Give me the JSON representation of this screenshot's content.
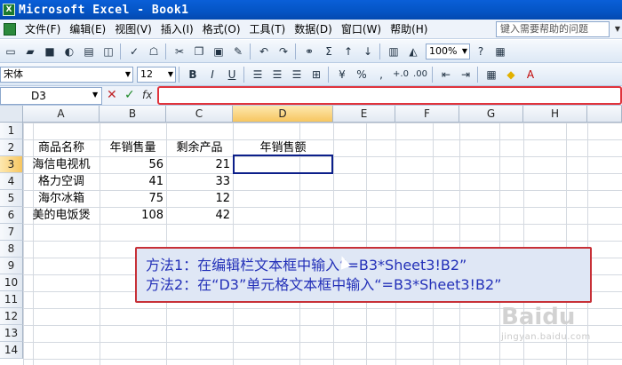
{
  "window": {
    "title": "Microsoft Excel - Book1"
  },
  "menu": {
    "items": [
      "文件(F)",
      "编辑(E)",
      "视图(V)",
      "插入(I)",
      "格式(O)",
      "工具(T)",
      "数据(D)",
      "窗口(W)",
      "帮助(H)"
    ],
    "help_placeholder": "键入需要帮助的问题"
  },
  "toolbar": {
    "zoom": "100%",
    "font_name": "宋体",
    "font_size": "12",
    "bold": "B",
    "italic": "I",
    "underline": "U",
    "currency": "%",
    "comma": ",",
    "inc_decimal": "+.0",
    "dec_decimal": ".00"
  },
  "formula_bar": {
    "name_box": "D3",
    "cancel": "✕",
    "enter": "✓",
    "fx": "fx",
    "value": ""
  },
  "sheet": {
    "columns": [
      "A",
      "B",
      "C",
      "D",
      "E",
      "F",
      "G",
      "H"
    ],
    "rows": [
      "1",
      "2",
      "3",
      "4",
      "5",
      "6",
      "7",
      "8",
      "9",
      "10",
      "11",
      "12",
      "13",
      "14"
    ],
    "active_cell": "D3",
    "cells": {
      "A2": "商品名称",
      "B2": "年销售量",
      "C2": "剩余产品",
      "D2": "年销售额",
      "A3": "海信电视机",
      "B3": "56",
      "C3": "21",
      "A4": "格力空调",
      "B4": "41",
      "C4": "33",
      "A5": "海尔冰箱",
      "B5": "75",
      "C5": "12",
      "A6": "美的电饭煲",
      "B6": "108",
      "C6": "42"
    }
  },
  "annotation": {
    "line1": "方法1：在编辑栏文本框中输入“=B3*Sheet3!B2”",
    "line2": "方法2：在“D3”单元格文本框中输入“=B3*Sheet3!B2”"
  },
  "watermark": {
    "logo": "Baidu",
    "sub": "jingyan.baidu.com"
  }
}
